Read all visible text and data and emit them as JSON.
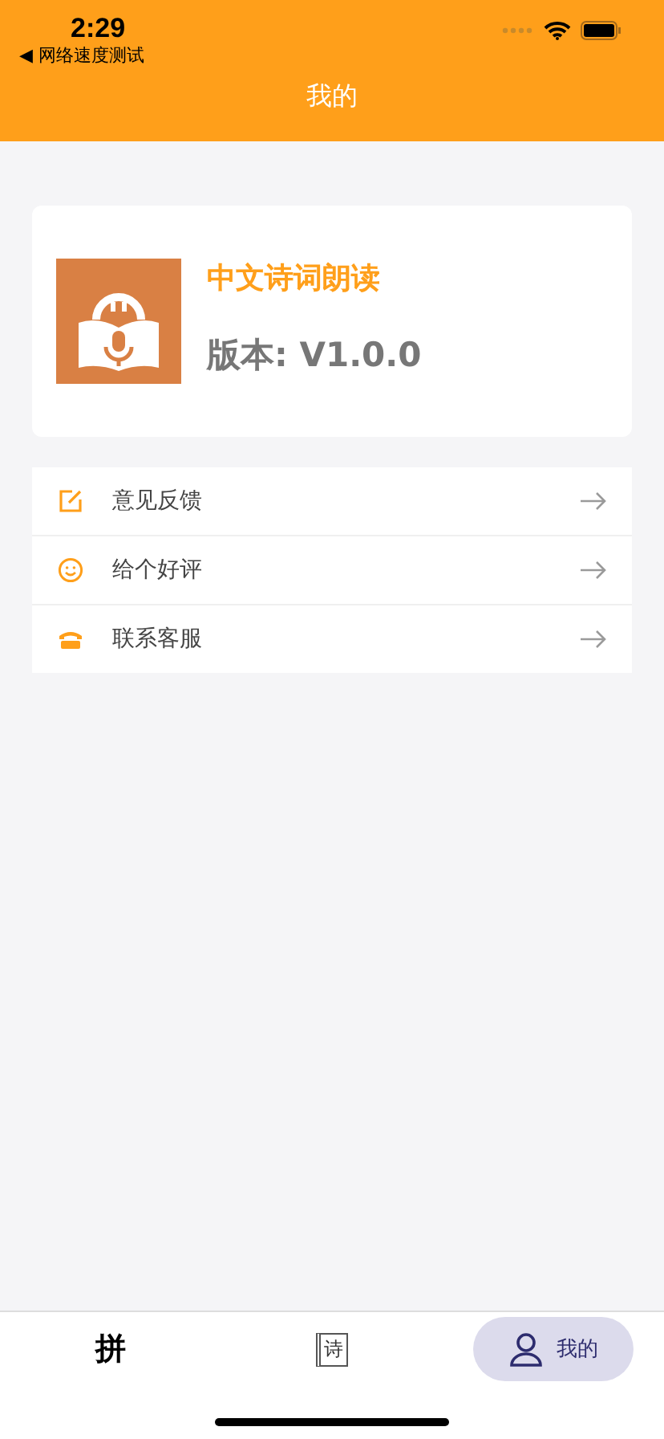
{
  "status_bar": {
    "time": "2:29",
    "back_label": "◀ 网络速度测试"
  },
  "nav": {
    "title": "我的"
  },
  "app_card": {
    "name": "中文诗词朗读",
    "version": "版本: V1.0.0"
  },
  "menu": [
    {
      "kind": "edit",
      "label": "意见反馈"
    },
    {
      "kind": "smile",
      "label": "给个好评"
    },
    {
      "kind": "phone",
      "label": "联系客服"
    }
  ],
  "tabs": [
    {
      "kind": "glyph",
      "label": "拼",
      "selected": false
    },
    {
      "kind": "notebook",
      "label": "诗",
      "selected": false
    },
    {
      "kind": "person",
      "label": "我的",
      "selected": true
    }
  ]
}
